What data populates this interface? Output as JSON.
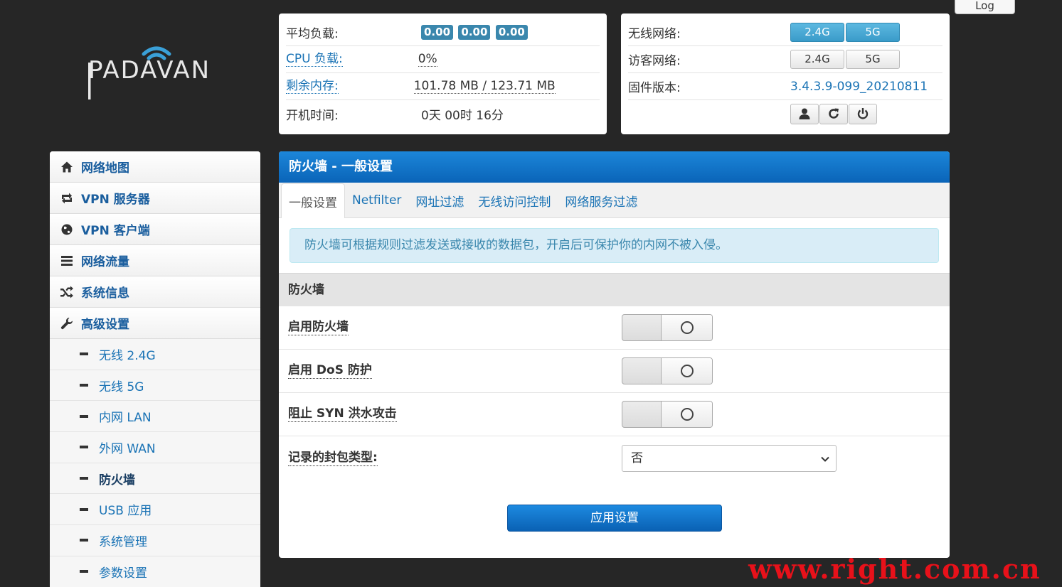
{
  "brand": {
    "logo_text": "PADAVAN"
  },
  "header": {
    "log_label": "Log"
  },
  "status": {
    "avg_load": {
      "label": "平均负载:",
      "values": [
        "0.00",
        "0.00",
        "0.00"
      ]
    },
    "cpu": {
      "label": "CPU 负载:",
      "value": "0%"
    },
    "memory": {
      "label": "剩余内存:",
      "value": "101.78 MB / 123.71 MB"
    },
    "uptime": {
      "label": "开机时间:",
      "value": "0天 00时 16分"
    }
  },
  "info": {
    "wireless": {
      "label": "无线网络:",
      "btn_24": "2.4G",
      "btn_5": "5G"
    },
    "guest": {
      "label": "访客网络:",
      "btn_24": "2.4G",
      "btn_5": "5G"
    },
    "firmware": {
      "label": "固件版本:",
      "value": "3.4.3.9-099_20210811"
    },
    "icons": [
      "user-icon",
      "refresh-icon",
      "power-icon"
    ]
  },
  "sidebar": {
    "items": [
      {
        "label": "网络地图",
        "icon": "home-icon"
      },
      {
        "label": "VPN 服务器",
        "icon": "retweet-icon"
      },
      {
        "label": "VPN 客户端",
        "icon": "globe-icon"
      },
      {
        "label": "网络流量",
        "icon": "list-icon"
      },
      {
        "label": "系统信息",
        "icon": "random-icon"
      },
      {
        "label": "高级设置",
        "icon": "wrench-icon"
      }
    ],
    "subitems": [
      {
        "label": "无线 2.4G"
      },
      {
        "label": "无线 5G"
      },
      {
        "label": "内网 LAN"
      },
      {
        "label": "外网 WAN"
      },
      {
        "label": "防火墙",
        "active": true
      },
      {
        "label": "USB 应用"
      },
      {
        "label": "系统管理"
      },
      {
        "label": "参数设置"
      }
    ]
  },
  "main": {
    "title": "防火墙 - 一般设置",
    "tabs": [
      "一般设置",
      "Netfilter",
      "网址过滤",
      "无线访问控制",
      "网络服务过滤"
    ],
    "alert": "防火墙可根据规则过滤发送或接收的数据包，开启后可保护你的内网不被入侵。",
    "section_title": "防火墙",
    "fields": {
      "enable_firewall": "启用防火墙",
      "enable_dos": "启用 DoS 防护",
      "block_syn": "阻止 SYN 洪水攻击",
      "log_packets": "记录的封包类型:"
    },
    "log_select_value": "否",
    "apply_label": "应用设置"
  },
  "watermark": "www.right.com.cn",
  "colors": {
    "accent": "#0a64b8",
    "badge": "#3a87ad",
    "link": "#1a73b5",
    "watermark": "#e8111a"
  }
}
